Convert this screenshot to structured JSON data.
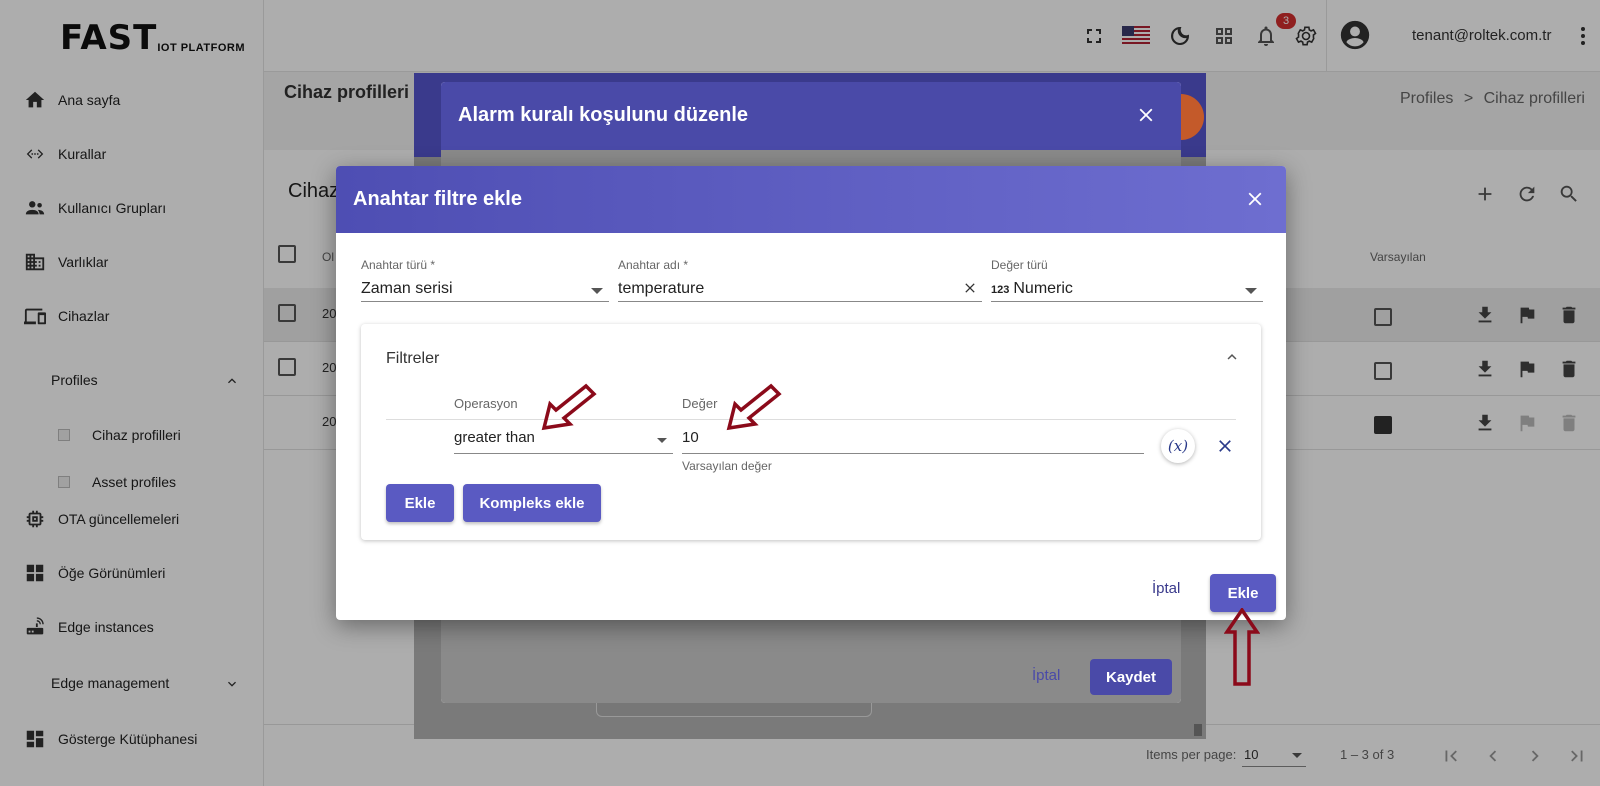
{
  "app": {
    "logo_main": "FAST",
    "logo_sub": "IOT PLATFORM",
    "user_email": "tenant@roltek.com.tr",
    "notification_count": "3"
  },
  "sidebar": {
    "items": [
      {
        "label": "Ana sayfa",
        "icon": "home-icon"
      },
      {
        "label": "Kurallar",
        "icon": "rule-chain-icon"
      },
      {
        "label": "Kullanıcı Grupları",
        "icon": "users-icon"
      },
      {
        "label": "Varlıklar",
        "icon": "building-icon"
      },
      {
        "label": "Cihazlar",
        "icon": "devices-icon"
      },
      {
        "label": "Profiles",
        "icon": "chevron-up-icon"
      },
      {
        "label": "Cihaz profilleri",
        "icon": "square-icon"
      },
      {
        "label": "Asset profiles",
        "icon": "square-icon"
      },
      {
        "label": "OTA güncellemeleri",
        "icon": "chip-icon"
      },
      {
        "label": "Öğe Görünümleri",
        "icon": "widgets-icon"
      },
      {
        "label": "Edge instances",
        "icon": "router-icon"
      },
      {
        "label": "Edge management",
        "icon": "chevron-down-icon"
      },
      {
        "label": "Gösterge Kütüphanesi",
        "icon": "dashboard-icon"
      }
    ]
  },
  "page": {
    "title": "Cihaz profilleri",
    "breadcrumb_root": "Profiles",
    "breadcrumb_sep": ">",
    "breadcrumb_current": "Cihaz profilleri",
    "card_title_partial": "Cihaz",
    "column_created_partial": "Ol",
    "column_default": "Varsayılan",
    "rows": [
      {
        "date_partial": "20",
        "default": false
      },
      {
        "date_partial": "20",
        "default": false
      },
      {
        "date_partial": "20",
        "default": true
      }
    ],
    "items_per_page_label": "Items per page:",
    "items_per_page_value": "10",
    "range_label": "1 – 3 of 3"
  },
  "alarm_dialog": {
    "title": "Alarm kuralı koşulunu düzenle",
    "cancel_label": "İptal",
    "save_label": "Kaydet"
  },
  "key_filter_dialog": {
    "title": "Anahtar filtre ekle",
    "key_type_label": "Anahtar türü *",
    "key_type_value": "Zaman serisi",
    "key_name_label": "Anahtar adı *",
    "key_name_value": "temperature",
    "value_type_label": "Değer türü",
    "value_type_icon": "123",
    "value_type_value": "Numeric",
    "filters_title": "Filtreler",
    "operation_label": "Operasyon",
    "value_label": "Değer",
    "operation_value": "greater than",
    "value_value": "10",
    "default_value_hint": "Varsayılan değer",
    "fx_label": "(x)",
    "add_label": "Ekle",
    "add_complex_label": "Kompleks ekle",
    "cancel_label": "İptal",
    "submit_label": "Ekle"
  },
  "colors": {
    "primary": "#5a5ac2",
    "header_dark": "#4a4aa8",
    "annotation_arrow": "#8b0a1a"
  }
}
